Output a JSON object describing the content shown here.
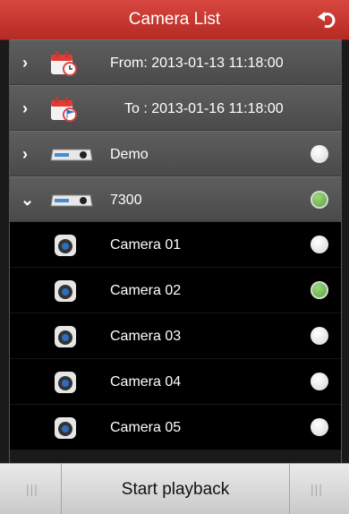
{
  "header": {
    "title": "Camera List"
  },
  "rows": {
    "from": {
      "label": "From: 2013-01-13 11:18:00"
    },
    "to": {
      "label": "To  : 2013-01-16 11:18:00"
    },
    "device1": {
      "label": "Demo",
      "expanded": false,
      "selected": false
    },
    "device2": {
      "label": "7300",
      "expanded": true,
      "selected": true
    }
  },
  "cameras": [
    {
      "label": "Camera 01",
      "selected": false
    },
    {
      "label": "Camera 02",
      "selected": true
    },
    {
      "label": "Camera 03",
      "selected": false
    },
    {
      "label": "Camera 04",
      "selected": false
    },
    {
      "label": "Camera 05",
      "selected": false
    }
  ],
  "footer": {
    "start_label": "Start playback"
  },
  "colors": {
    "header": "#c5352e",
    "selected": "#5aa93f"
  }
}
